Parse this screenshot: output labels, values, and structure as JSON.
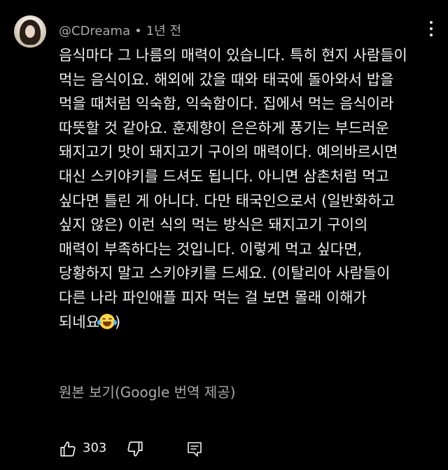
{
  "comment": {
    "author": "@CDreama",
    "separator": "•",
    "time": "1년 전",
    "body_lines": [
      "음식마다 그 나름의 매력이 있습니다. 특히 현지 사람들이",
      "먹는 음식이요. 해외에 갔을 때와 태국에 돌아와서 밥을",
      "먹을 때처럼 익숙함, 익숙함이다. 집에서 먹는 음식이라",
      "따뜻할 것 같아요. 훈제향이 은은하게 풍기는 부드러운",
      "돼지고기 맛이 돼지고기 구이의 매력이다. 예의바르시면",
      "대신 스키야키를 드셔도 됩니다. 아니면 삼촌처럼 먹고",
      "싶다면 틀린 게 아니다. 다만 태국인으로서 (일반화하고",
      "싶지 않은) 이런 식의 먹는 방식은 돼지고기 구이의",
      "매력이 부족하다는 것입니다. 이렇게 먹고 싶다면,",
      "당황하지 말고 스키야키를 드세요. (이탈리아 사람들이",
      "다른 나라 파인애플 피자 먹는 걸 보면 몰래 이해가"
    ],
    "body_last_line_text": "되네요",
    "body_last_line_tail": ")",
    "emoji_name": "face-with-tears-of-joy",
    "translate_link": "원본 보기(Google 번역 제공)",
    "like_count": "303"
  },
  "icons": {
    "more": "more-vertical-icon",
    "like": "thumbs-up-icon",
    "dislike": "thumbs-down-icon",
    "reply": "reply-comment-icon"
  },
  "colors": {
    "background": "#000000",
    "text": "#f1f1f1",
    "secondary_text": "#aaaaaa"
  }
}
